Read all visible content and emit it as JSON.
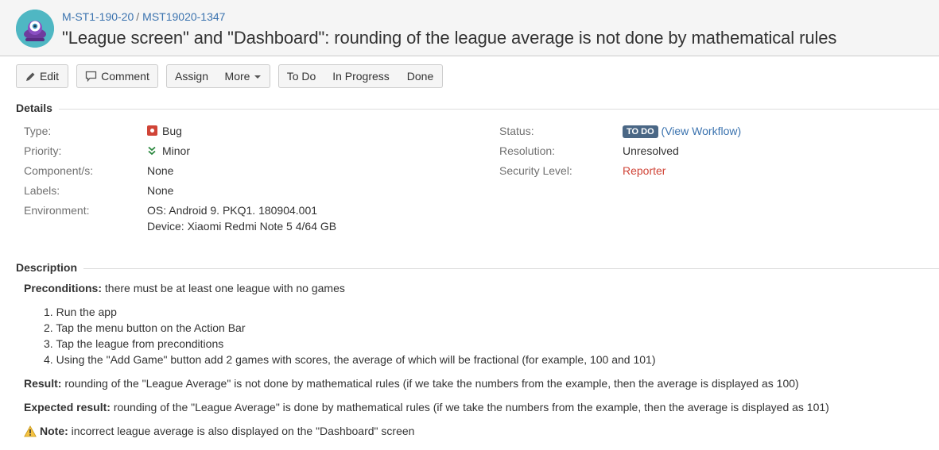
{
  "header": {
    "project_key": "M-ST1-190-20",
    "separator": "/",
    "issue_key": "MST19020-1347",
    "title": "\"League screen\" and \"Dashboard\": rounding of the league average is not done by mathematical rules"
  },
  "toolbar": {
    "edit": "Edit",
    "comment": "Comment",
    "assign": "Assign",
    "more": "More",
    "todo": "To Do",
    "in_progress": "In Progress",
    "done": "Done"
  },
  "details": {
    "heading": "Details",
    "type_label": "Type:",
    "type_value": "Bug",
    "priority_label": "Priority:",
    "priority_value": "Minor",
    "components_label": "Component/s:",
    "components_value": "None",
    "labels_label": "Labels:",
    "labels_value": "None",
    "environment_label": "Environment:",
    "environment_line1": "OS: Android 9. PKQ1. 180904.001",
    "environment_line2": "Device: Xiaomi Redmi Note 5 4/64 GB",
    "status_label": "Status:",
    "status_value": "TO DO",
    "view_workflow_open": "(",
    "view_workflow": "View Workflow",
    "view_workflow_close": ")",
    "resolution_label": "Resolution:",
    "resolution_value": "Unresolved",
    "security_label": "Security Level:",
    "security_value": "Reporter"
  },
  "description": {
    "heading": "Description",
    "preconditions_label": "Preconditions:",
    "preconditions_text": " there must be at least one league with no games",
    "steps": [
      {
        "num": "1.",
        "text": "Run the app"
      },
      {
        "num": "2.",
        "text": "Tap the menu button on the Action Bar"
      },
      {
        "num": "3.",
        "text": "Tap the league from preconditions"
      },
      {
        "num": "4.",
        "text": "Using the \"Add Game\" button add 2 games with scores, the average of which will be fractional (for example, 100 and 101)"
      }
    ],
    "result_label": "Result:",
    "result_text": " rounding of the \"League Average\" is not done by mathematical rules (if we take the numbers from the example, then the average is displayed as 100)",
    "expected_label": "Expected result:",
    "expected_text": " rounding of the \"League Average\" is done by mathematical rules (if we take the numbers from the example, then the average is displayed as 101)",
    "note_label": "Note:",
    "note_text": " incorrect league average is also displayed on the \"Dashboard\" screen"
  },
  "colors": {
    "link": "#3b73af",
    "bug": "#d04437",
    "priority_minor": "#29873d",
    "status_todo": "#4a6785",
    "warning": "#f6c342"
  }
}
